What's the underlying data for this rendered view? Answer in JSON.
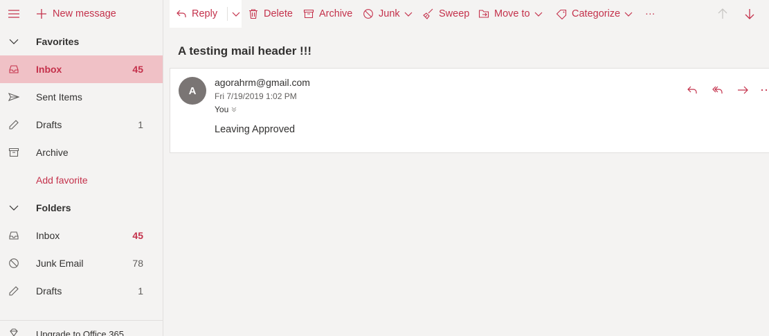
{
  "sidebar": {
    "new_message_label": "New message",
    "favorites": {
      "header": "Favorites",
      "items": [
        {
          "label": "Inbox",
          "count": "45",
          "icon": "inbox-icon"
        },
        {
          "label": "Sent Items",
          "count": "",
          "icon": "send-icon"
        },
        {
          "label": "Drafts",
          "count": "1",
          "icon": "pencil-icon"
        },
        {
          "label": "Archive",
          "count": "",
          "icon": "archive-icon"
        }
      ],
      "add_favorite": "Add favorite"
    },
    "folders": {
      "header": "Folders",
      "items": [
        {
          "label": "Inbox",
          "count": "45",
          "icon": "inbox-icon"
        },
        {
          "label": "Junk Email",
          "count": "78",
          "icon": "blocked-icon"
        },
        {
          "label": "Drafts",
          "count": "1",
          "icon": "pencil-icon"
        }
      ]
    },
    "upgrade_label": "Upgrade to Office 365"
  },
  "toolbar": {
    "reply": "Reply",
    "delete": "Delete",
    "archive": "Archive",
    "junk": "Junk",
    "sweep": "Sweep",
    "move_to": "Move to",
    "categorize": "Categorize",
    "more": "···"
  },
  "message": {
    "subject": "A testing mail header !!!",
    "avatar_initial": "A",
    "sender": "agorahrm@gmail.com",
    "date": "Fri 7/19/2019 1:02 PM",
    "to": "You",
    "body": "Leaving Approved"
  },
  "colors": {
    "accent": "#c4314b",
    "selected_bg": "#f0c1c6",
    "avatar_bg": "#7a7574"
  }
}
